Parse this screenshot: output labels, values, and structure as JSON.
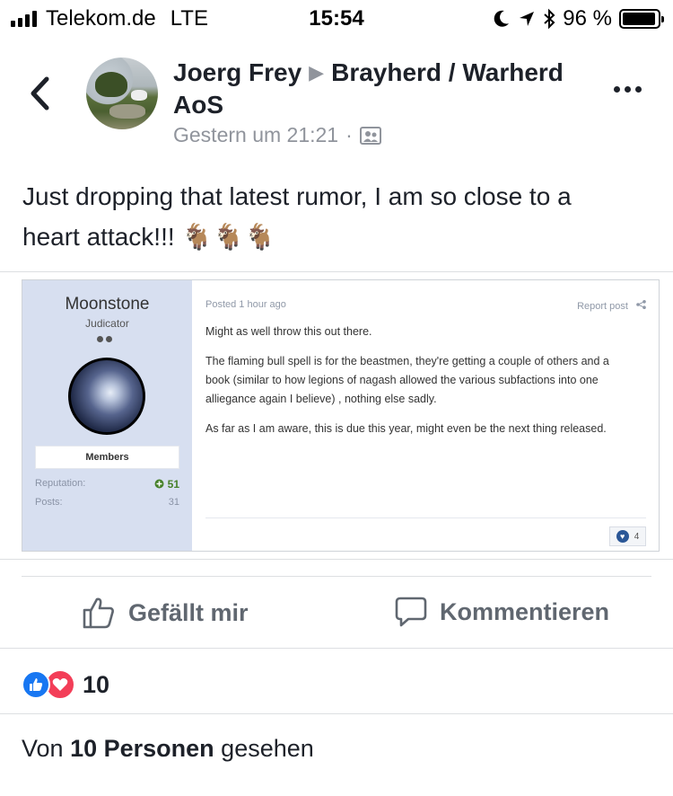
{
  "status_bar": {
    "carrier": "Telekom.de",
    "network": "LTE",
    "time": "15:54",
    "battery": "96 %",
    "battery_level": 0.96
  },
  "post": {
    "author": "Joerg Frey",
    "group": "Brayherd / Warherd AoS",
    "timestamp": "Gestern um 21:21",
    "separator": "·",
    "text_line1": "Just dropping that latest rumor, I am so close to a",
    "text_line2": "heart attack!!! 🐐🐐🐐"
  },
  "embed": {
    "username": "Moonstone",
    "rank": "Judicator",
    "group_badge": "Members",
    "reputation_label": "Reputation:",
    "reputation_value": "51",
    "posts_label": "Posts:",
    "posts_value": "31",
    "posted": "Posted 1 hour ago",
    "report": "Report post",
    "para1": "Might as well throw this out there.",
    "para2": "The flaming bull spell is for the beastmen, they're getting a couple of others and a book (similar to how legions of nagash allowed the various subfactions into one alliegance again I believe) , nothing else sadly.",
    "para3": "As far as I am aware,  this is due this year, might even be the next thing released.",
    "reaction_count": "4"
  },
  "actions": {
    "like": "Gefällt mir",
    "comment": "Kommentieren"
  },
  "reactions": {
    "count": "10"
  },
  "seen": {
    "prefix": "Von",
    "bold": "10 Personen",
    "suffix": "gesehen"
  }
}
